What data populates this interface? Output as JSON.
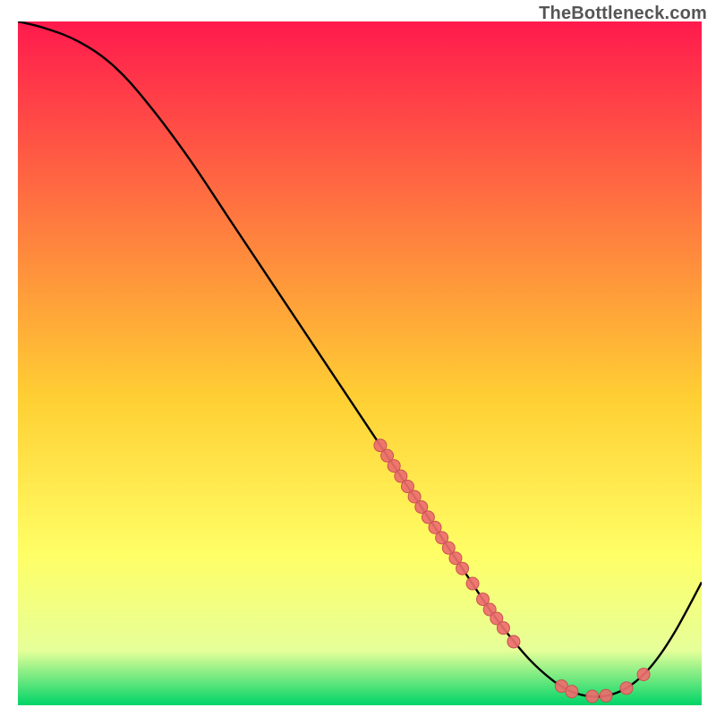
{
  "watermark": "TheBottleneck.com",
  "chart_data": {
    "type": "line",
    "title": "",
    "xlabel": "",
    "ylabel": "",
    "xlim": [
      0,
      100
    ],
    "ylim": [
      0,
      100
    ],
    "grid": false,
    "legend": false,
    "gradient_colors": {
      "top": "#ff1a4d",
      "mid1": "#ffcf33",
      "mid2": "#ffff66",
      "mid3": "#e6ff99",
      "bottom": "#00d468"
    },
    "series": [
      {
        "name": "curve",
        "points": [
          {
            "x": 0,
            "y": 100
          },
          {
            "x": 4,
            "y": 99
          },
          {
            "x": 9,
            "y": 97
          },
          {
            "x": 14,
            "y": 93.5
          },
          {
            "x": 19,
            "y": 88
          },
          {
            "x": 25,
            "y": 80
          },
          {
            "x": 31,
            "y": 71
          },
          {
            "x": 37,
            "y": 62
          },
          {
            "x": 43,
            "y": 53
          },
          {
            "x": 49,
            "y": 44
          },
          {
            "x": 53,
            "y": 38
          },
          {
            "x": 57,
            "y": 32
          },
          {
            "x": 60,
            "y": 27.5
          },
          {
            "x": 63,
            "y": 23
          },
          {
            "x": 66,
            "y": 18.5
          },
          {
            "x": 69,
            "y": 14
          },
          {
            "x": 72,
            "y": 10
          },
          {
            "x": 75,
            "y": 6.5
          },
          {
            "x": 78,
            "y": 3.8
          },
          {
            "x": 80.5,
            "y": 2.2
          },
          {
            "x": 83,
            "y": 1.4
          },
          {
            "x": 85.5,
            "y": 1.3
          },
          {
            "x": 88,
            "y": 2.0
          },
          {
            "x": 90,
            "y": 3.2
          },
          {
            "x": 92,
            "y": 5.0
          },
          {
            "x": 94,
            "y": 7.5
          },
          {
            "x": 96,
            "y": 10.6
          },
          {
            "x": 98,
            "y": 14.2
          },
          {
            "x": 100,
            "y": 18.0
          }
        ]
      }
    ],
    "markers": [
      {
        "x": 53,
        "y": 38
      },
      {
        "x": 54,
        "y": 36.5
      },
      {
        "x": 55,
        "y": 35
      },
      {
        "x": 56,
        "y": 33.5
      },
      {
        "x": 57,
        "y": 32
      },
      {
        "x": 58,
        "y": 30.5
      },
      {
        "x": 59,
        "y": 29
      },
      {
        "x": 60,
        "y": 27.5
      },
      {
        "x": 61,
        "y": 26
      },
      {
        "x": 62,
        "y": 24.5
      },
      {
        "x": 63,
        "y": 23
      },
      {
        "x": 64,
        "y": 21.5
      },
      {
        "x": 65,
        "y": 20
      },
      {
        "x": 66.5,
        "y": 17.8
      },
      {
        "x": 68,
        "y": 15.5
      },
      {
        "x": 69,
        "y": 14
      },
      {
        "x": 70,
        "y": 12.7
      },
      {
        "x": 71,
        "y": 11.3
      },
      {
        "x": 72.5,
        "y": 9.3
      },
      {
        "x": 79.5,
        "y": 2.8
      },
      {
        "x": 81,
        "y": 2.0
      },
      {
        "x": 84,
        "y": 1.3
      },
      {
        "x": 86,
        "y": 1.4
      },
      {
        "x": 89,
        "y": 2.5
      },
      {
        "x": 91.5,
        "y": 4.5
      }
    ],
    "marker_color": "#ed6e6e",
    "marker_stroke": "#c95151",
    "marker_radius": 7
  }
}
